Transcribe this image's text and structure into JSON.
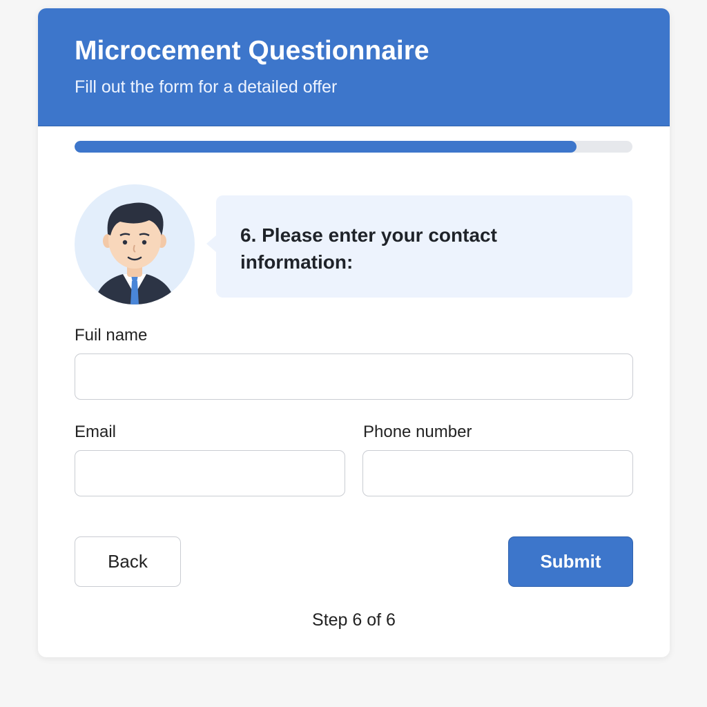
{
  "header": {
    "title": "Microcement Questionnaire",
    "subtitle": "Fill out the form for a detailed offer"
  },
  "progress": {
    "fraction": 0.9
  },
  "question": {
    "text": "6. Please enter your contact information:"
  },
  "form": {
    "full_name": {
      "label": "Fuil name",
      "value": "",
      "placeholder": ""
    },
    "email": {
      "label": "Email",
      "value": "",
      "placeholder": ""
    },
    "phone": {
      "label": "Phone number",
      "value": "",
      "placeholder": ""
    }
  },
  "buttons": {
    "back": "Back",
    "submit": "Submit"
  },
  "footer": {
    "step": "Step 6 of 6"
  },
  "colors": {
    "accent": "#3d76cb",
    "bubble": "#edf3fd",
    "avatar_bg": "#e3eefb"
  },
  "icons": {
    "avatar": "man-in-suit-avatar"
  }
}
